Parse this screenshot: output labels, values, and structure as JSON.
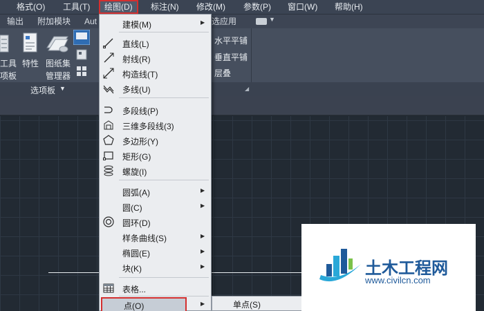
{
  "menubar": {
    "items": [
      {
        "label": "格式(O)"
      },
      {
        "label": "工具(T)"
      },
      {
        "label": "绘图(D)"
      },
      {
        "label": "标注(N)"
      },
      {
        "label": "修改(M)"
      },
      {
        "label": "参数(P)"
      },
      {
        "label": "窗口(W)"
      },
      {
        "label": "帮助(H)"
      }
    ]
  },
  "ribbon": {
    "tabs": [
      {
        "label": "输出"
      },
      {
        "label": "附加模块"
      },
      {
        "label": "Aut"
      },
      {
        "label": "选应用"
      }
    ],
    "panel": {
      "tool_label_1": "工具",
      "tool_label_2": "项板",
      "properties_label": "特性",
      "sheetset_label_1": "图纸集",
      "sheetset_label_2": "管理器",
      "tile_h_label": "水平平铺",
      "tile_v_label": "垂直平铺",
      "cascade_label": "层叠",
      "panel_title": "选项板"
    }
  },
  "draw_menu": {
    "items": [
      {
        "label": "建模(M)",
        "submenu": true
      },
      {
        "label": "直线(L)"
      },
      {
        "label": "射线(R)"
      },
      {
        "label": "构造线(T)"
      },
      {
        "label": "多线(U)"
      },
      {
        "label": "多段线(P)"
      },
      {
        "label": "三维多段线(3)"
      },
      {
        "label": "多边形(Y)"
      },
      {
        "label": "矩形(G)"
      },
      {
        "label": "螺旋(I)"
      },
      {
        "label": "圆弧(A)",
        "submenu": true
      },
      {
        "label": "圆(C)",
        "submenu": true
      },
      {
        "label": "圆环(D)"
      },
      {
        "label": "样条曲线(S)",
        "submenu": true
      },
      {
        "label": "椭圆(E)",
        "submenu": true
      },
      {
        "label": "块(K)",
        "submenu": true
      },
      {
        "label": "表格..."
      },
      {
        "label": "点(O)",
        "submenu": true,
        "highlighted": true
      }
    ]
  },
  "point_submenu": {
    "items": [
      {
        "label": "单点(S)"
      }
    ]
  },
  "watermark": {
    "title": "土木工程网",
    "url": "www.civilcn.com"
  },
  "colors": {
    "highlight_border": "#d42f2f",
    "menu_bg": "#ebedf0",
    "canvas_bg": "#222a33",
    "ribbon_bg": "#464f5e"
  }
}
